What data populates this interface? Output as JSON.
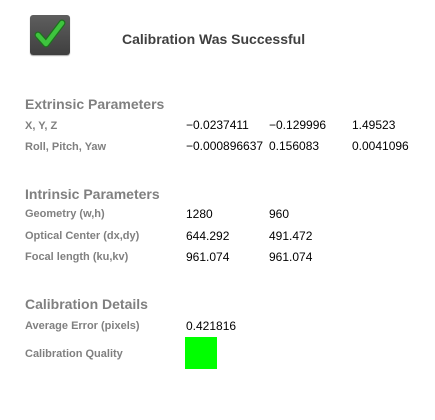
{
  "header": {
    "title": "Calibration Was Successful",
    "status_icon": "checkmark-icon"
  },
  "extrinsic": {
    "heading": "Extrinsic Parameters",
    "rows": [
      {
        "label": "X, Y, Z",
        "values": [
          "−0.0237411",
          "−0.129996",
          "1.49523"
        ]
      },
      {
        "label": "Roll, Pitch, Yaw",
        "values": [
          "−0.000896637",
          "0.156083",
          "0.0041096"
        ]
      }
    ]
  },
  "intrinsic": {
    "heading": "Intrinsic Parameters",
    "rows": [
      {
        "label": "Geometry (w,h)",
        "values": [
          "1280",
          "960"
        ]
      },
      {
        "label": "Optical Center (dx,dy)",
        "values": [
          "644.292",
          "491.472"
        ]
      },
      {
        "label": "Focal length (ku,kv)",
        "values": [
          "961.074",
          "961.074"
        ]
      }
    ]
  },
  "details": {
    "heading": "Calibration Details",
    "average_error_label": "Average Error (pixels)",
    "average_error_value": "0.421816",
    "quality_label": "Calibration Quality",
    "quality_color": "#00ff00"
  },
  "colors": {
    "check_green": "#3ec43e",
    "heading_gray": "#808080"
  }
}
